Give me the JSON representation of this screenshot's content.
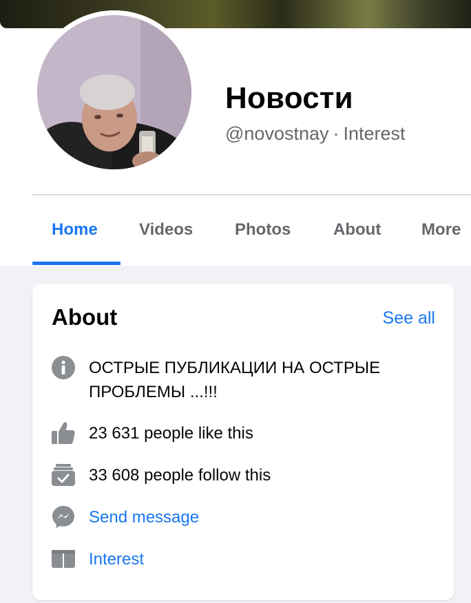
{
  "page": {
    "name": "Новости",
    "handle": "@novostnay",
    "separator": "·",
    "category": "Interest"
  },
  "tabs": [
    {
      "label": "Home",
      "active": true
    },
    {
      "label": "Videos",
      "active": false
    },
    {
      "label": "Photos",
      "active": false
    },
    {
      "label": "About",
      "active": false
    },
    {
      "label": "More",
      "active": false
    }
  ],
  "about": {
    "title": "About",
    "see_all": "See all",
    "items": [
      {
        "icon": "info-icon",
        "text": "ОСТРЫЕ ПУБЛИКАЦИИ НА ОСТРЫЕ ПРОБЛЕМЫ ...!!!"
      },
      {
        "icon": "like-icon",
        "text": "23 631 people like this"
      },
      {
        "icon": "follow-icon",
        "text": "33 608 people follow this"
      },
      {
        "icon": "messenger-icon",
        "text": "Send message"
      },
      {
        "icon": "category-icon",
        "text": "Interest"
      }
    ]
  },
  "colors": {
    "accent": "#1877f2",
    "icon_gray": "#8a8d91",
    "secondary_text": "#65676b",
    "background": "#f0f2f5"
  }
}
